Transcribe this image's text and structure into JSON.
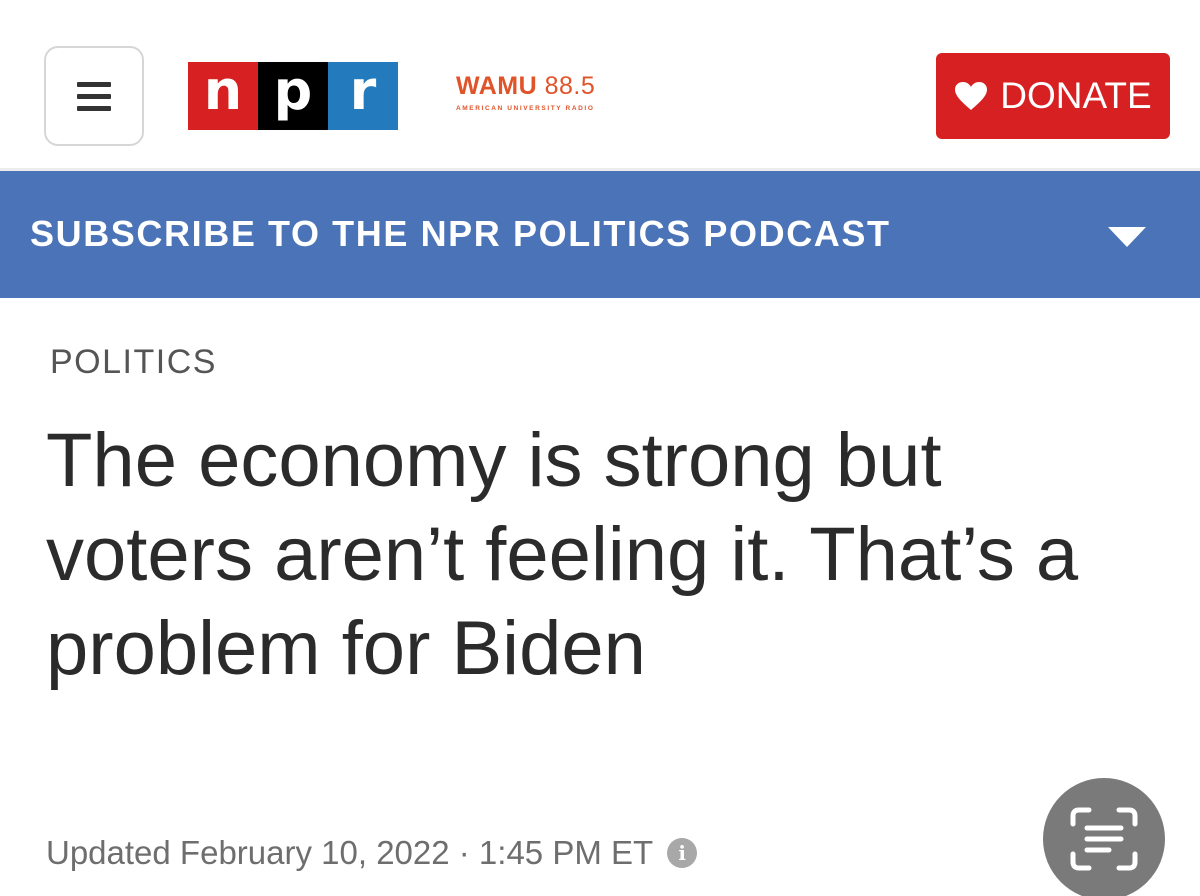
{
  "header": {
    "menu_icon": "hamburger-menu-icon",
    "logo": {
      "letters": [
        "n",
        "p",
        "r"
      ],
      "colors": [
        "#d62021",
        "#000000",
        "#237bbd"
      ]
    },
    "station": {
      "call_sign": "WAMU",
      "frequency": "88.5",
      "subtitle": "AMERICAN UNIVERSITY RADIO",
      "color": "#e0542a"
    },
    "donate": {
      "label": "DONATE",
      "icon": "heart-icon",
      "color": "#d62021"
    }
  },
  "subscribe_bar": {
    "text": "SUBSCRIBE TO THE NPR POLITICS PODCAST",
    "icon": "chevron-down-icon",
    "color": "#4b73b8"
  },
  "article": {
    "section": "POLITICS",
    "headline": "The economy is strong but voters aren’t feeling it. That’s a problem for Biden",
    "updated": "Updated February 10, 2022 · 1:45 PM ET",
    "info_icon": "info-icon"
  },
  "overlay": {
    "scan_button_icon": "text-scan-icon"
  }
}
